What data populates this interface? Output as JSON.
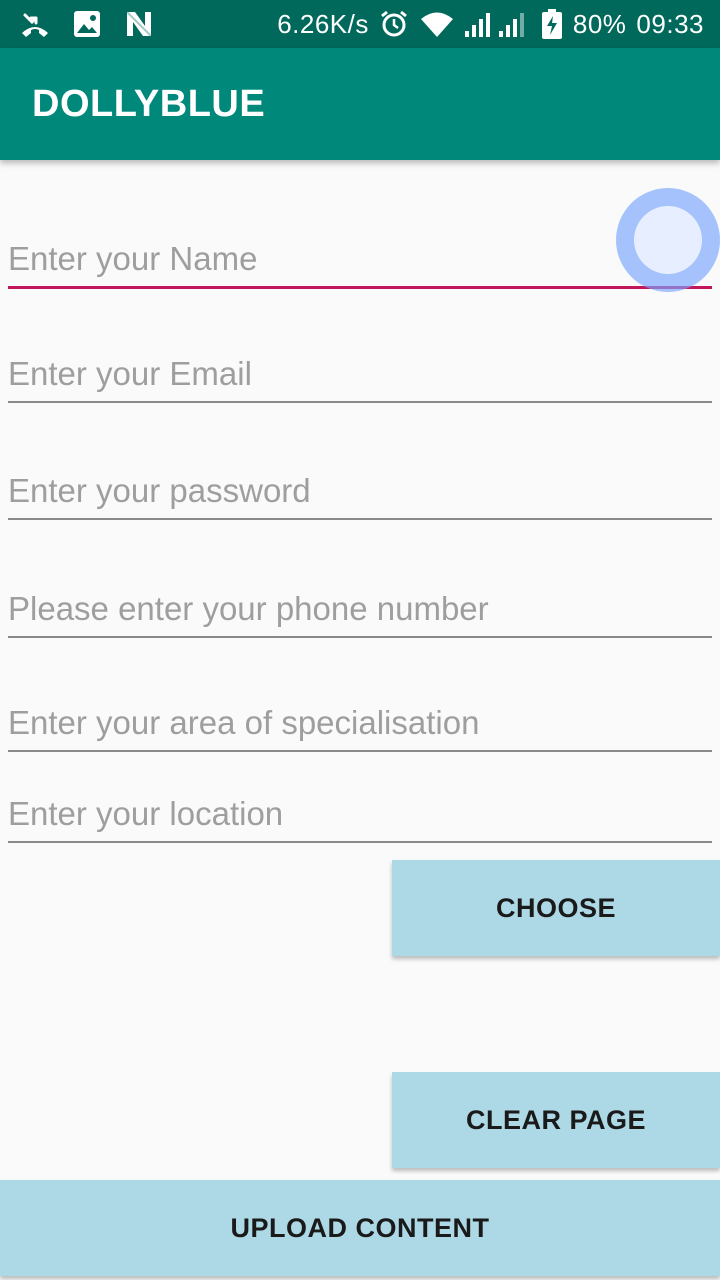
{
  "status_bar": {
    "speed": "6.26K/s",
    "battery": "80%",
    "time": "09:33",
    "icons": [
      "missed-call-icon",
      "image-icon",
      "n-notification-icon",
      "alarm-icon",
      "wifi-icon",
      "signal-icon",
      "battery-charging-icon"
    ]
  },
  "app_bar": {
    "title": "DOLLYBLUE"
  },
  "form": {
    "name_placeholder": "Enter your Name",
    "email_placeholder": "Enter your Email",
    "password_placeholder": "Enter your password",
    "phone_placeholder": "Please enter your phone number",
    "specialisation_placeholder": "Enter your area of specialisation",
    "location_placeholder": "Enter your location"
  },
  "buttons": {
    "choose": "CHOOSE",
    "clear_page": "CLEAR PAGE",
    "upload_content": "UPLOAD CONTENT"
  },
  "colors": {
    "status_bar": "#00695c",
    "app_bar": "#00897b",
    "focus_accent": "#c2185b",
    "button": "#add8e6"
  }
}
